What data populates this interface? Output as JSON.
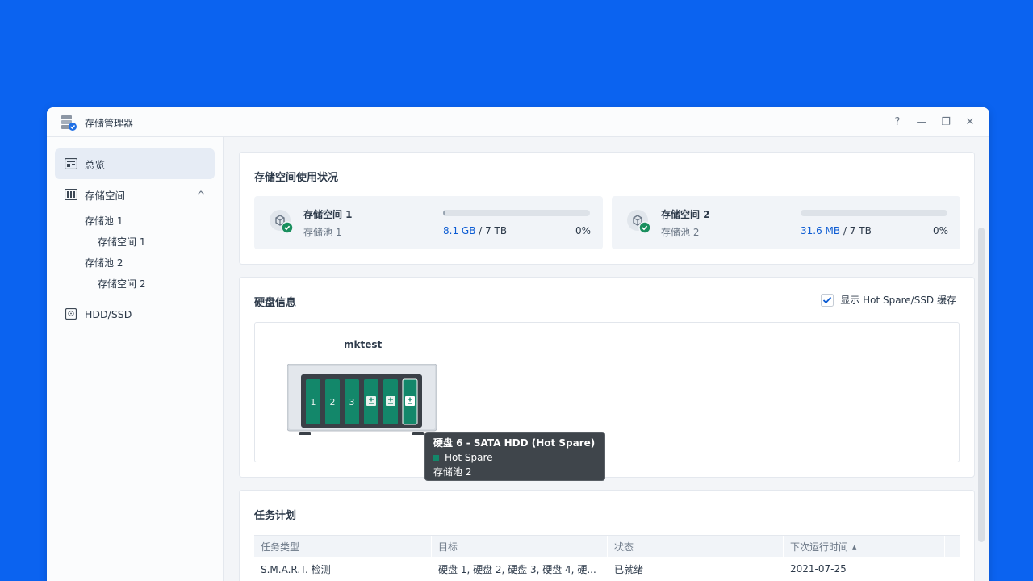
{
  "app": {
    "title": "存储管理器",
    "icon": "storage-manager-icon"
  },
  "window_controls": {
    "help": "?",
    "minimize": "—",
    "maximize": "❐",
    "close": "✕"
  },
  "sidebar": {
    "overview": "总览",
    "storage": "存储空间",
    "pool1": "存储池 1",
    "vol1": "存储空间 1",
    "pool2": "存储池 2",
    "vol2": "存储空间 2",
    "hdd": "HDD/SSD"
  },
  "usage": {
    "title": "存储空间使用状况",
    "volumes": [
      {
        "name": "存储空间 1",
        "pool": "存储池 1",
        "used": "8.1 GB",
        "total": " / 7 TB",
        "percent": "0%",
        "fill": 0.003
      },
      {
        "name": "存储空间 2",
        "pool": "存储池 2",
        "used": "31.6 MB",
        "total": " / 7 TB",
        "percent": "0%",
        "fill": 0.0
      }
    ]
  },
  "disk_info": {
    "title": "硬盘信息",
    "show_hotspare_label": "显示 Hot Spare/SSD 缓存",
    "show_hotspare_checked": true,
    "device_name": "mktest",
    "bays": [
      "1",
      "2",
      "3",
      "",
      "",
      ""
    ]
  },
  "tooltip": {
    "title": "硬盘 6 - SATA HDD (Hot Spare)",
    "status": "Hot Spare",
    "pool": "存储池 2"
  },
  "tasks": {
    "title": "任务计划",
    "columns": [
      "任务类型",
      "目标",
      "状态",
      "下次运行时间"
    ],
    "sort_indicator": "▲",
    "rows": [
      {
        "type": "S.M.A.R.T. 检测",
        "target": "硬盘 1, 硬盘 2, 硬盘 3, 硬盘 4, 硬...",
        "status": "已就绪",
        "next_run": "2021-07-25"
      }
    ]
  },
  "colors": {
    "accent": "#0b5bd3",
    "background": "#0b63f0",
    "disk_green": "#13876a",
    "status_green": "#1a8f5e"
  }
}
